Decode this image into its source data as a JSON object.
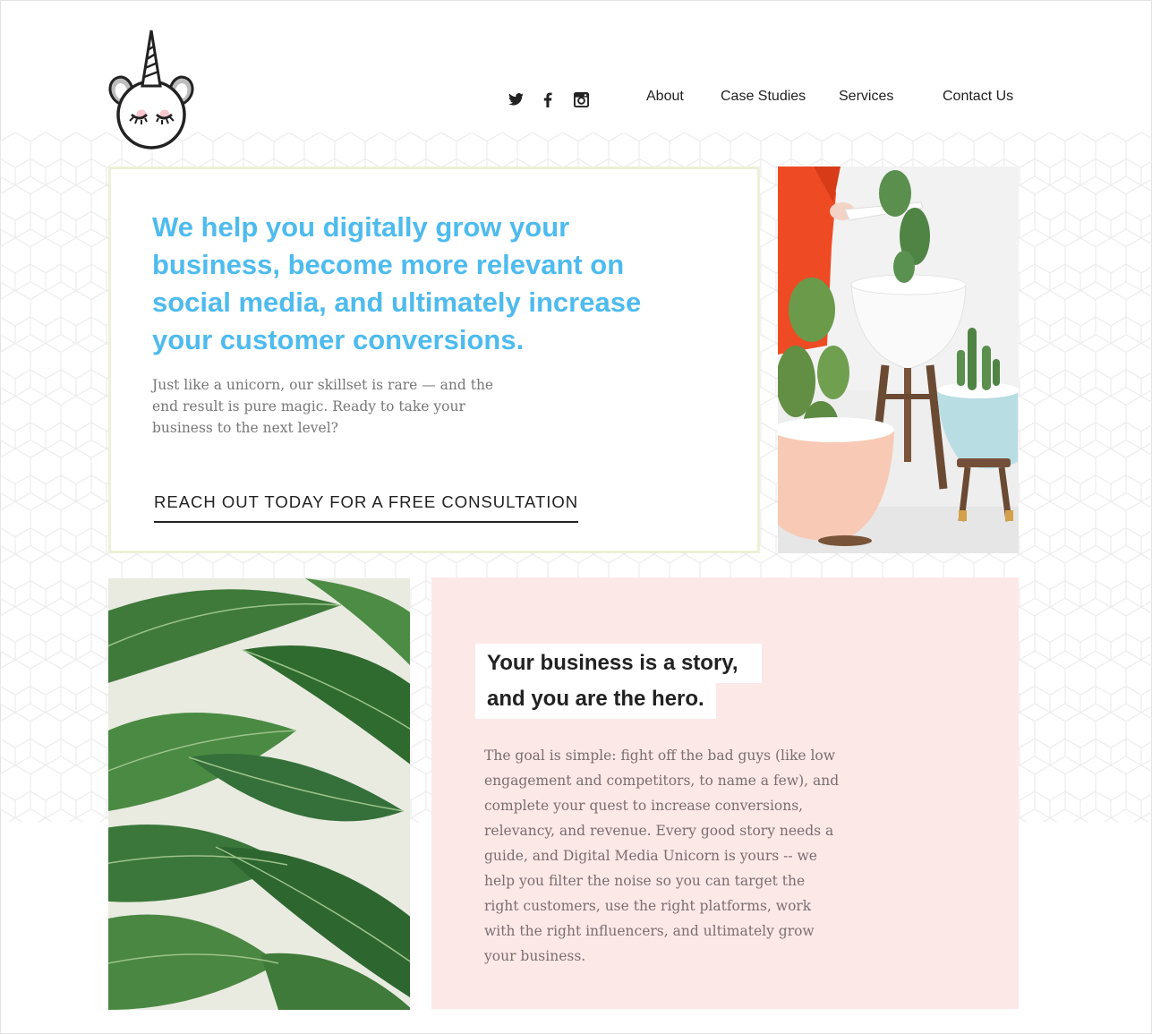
{
  "nav": {
    "items": [
      {
        "label": "About"
      },
      {
        "label": "Case Studies"
      },
      {
        "label": "Services"
      },
      {
        "label": "Contact Us"
      }
    ],
    "social": [
      "twitter-icon",
      "facebook-icon",
      "instagram-icon"
    ]
  },
  "hero": {
    "title": "We help you digitally grow your business, become more relevant on social media, and ultimately increase your customer conversions.",
    "subtitle": "Just like a unicorn, our skillset is rare — and the end result is pure magic. Ready to take your business to the next level?",
    "cta_label": "REACH OUT TODAY FOR A FREE CONSULTATION"
  },
  "story": {
    "heading_line1": "Your business is a story,",
    "heading_line2": "and you are the hero.",
    "body": "The goal is simple: fight off the bad guys (like low engagement and competitors, to name a few), and complete your quest to increase conversions, relevancy, and revenue. Every good story needs a guide, and Digital Media Unicorn is yours -- we help you filter the noise so you can target the right customers, use the right platforms, work with the right influencers, and ultimately grow your business."
  },
  "colors": {
    "accent_blue": "#4ebbee",
    "story_bg": "#fde8e8",
    "card_border": "#eef0d8",
    "text_dark": "#222222"
  }
}
